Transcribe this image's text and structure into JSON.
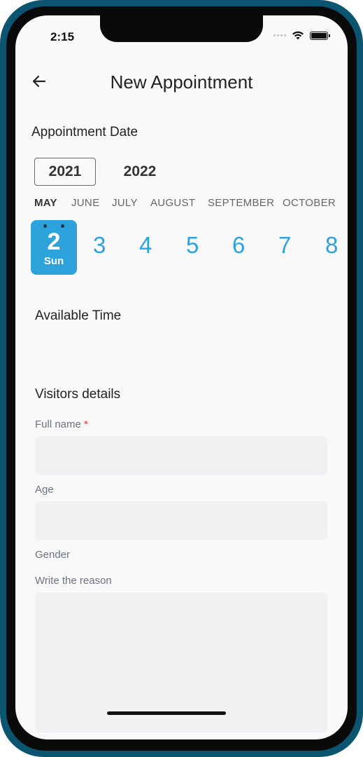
{
  "status_bar": {
    "time": "2:15"
  },
  "header": {
    "title": "New Appointment"
  },
  "appointment_date": {
    "label": "Appointment Date",
    "years": [
      "2021",
      "2022"
    ],
    "selected_year": "2021",
    "months": [
      "MAY",
      "JUNE",
      "JULY",
      "AUGUST",
      "SEPTEMBER",
      "OCTOBER"
    ],
    "selected_month": "MAY",
    "days": [
      {
        "num": "2",
        "dow": "Sun"
      },
      {
        "num": "3"
      },
      {
        "num": "4"
      },
      {
        "num": "5"
      },
      {
        "num": "6"
      },
      {
        "num": "7"
      },
      {
        "num": "8"
      }
    ]
  },
  "available_time": {
    "label": "Available Time"
  },
  "visitors": {
    "label": "Visitors details",
    "full_name_label": "Full name",
    "required_marker": "*",
    "age_label": "Age",
    "gender_label": "Gender",
    "reason_label": "Write the reason"
  },
  "colors": {
    "accent": "#2ea3db",
    "frame": "#0b5570",
    "input_bg": "#f0f1f3"
  }
}
